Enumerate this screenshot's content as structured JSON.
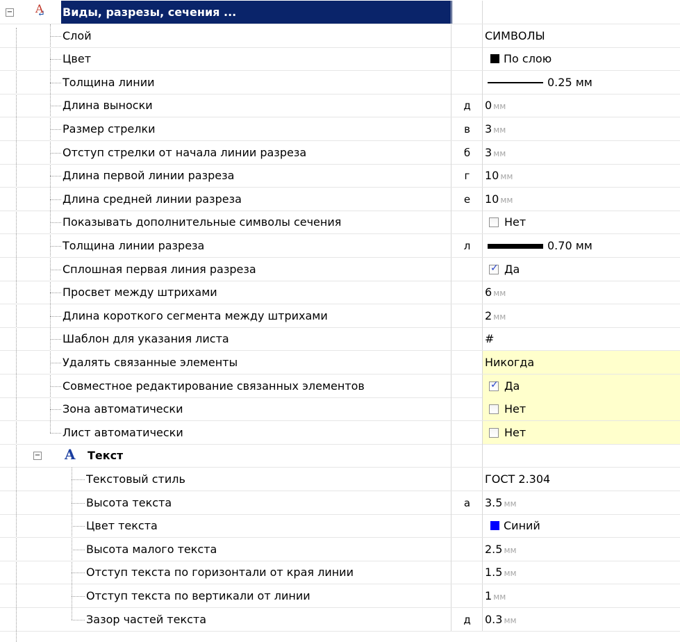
{
  "sections": [
    {
      "title": "Виды, разрезы, сечения ...",
      "icon": "section-view-icon",
      "selected": true,
      "rows": [
        {
          "name": "Слой",
          "key": "",
          "type": "text",
          "value": "СИМВОЛЫ"
        },
        {
          "name": "Цвет",
          "key": "",
          "type": "color",
          "value": "По слою",
          "color": "#000000"
        },
        {
          "name": "Толщина линии",
          "key": "",
          "type": "lineweight",
          "value": "0.25 мм",
          "weight": 2
        },
        {
          "name": "Длина выноски",
          "key": "д",
          "type": "unit",
          "value": "0",
          "unit": "мм"
        },
        {
          "name": "Размер стрелки",
          "key": "в",
          "type": "unit",
          "value": "3",
          "unit": "мм"
        },
        {
          "name": "Отступ стрелки от начала линии разреза",
          "key": "б",
          "type": "unit",
          "value": "3",
          "unit": "мм"
        },
        {
          "name": "Длина первой линии разреза",
          "key": "г",
          "type": "unit",
          "value": "10",
          "unit": "мм"
        },
        {
          "name": "Длина средней линии разреза",
          "key": "е",
          "type": "unit",
          "value": "10",
          "unit": "мм"
        },
        {
          "name": "Показывать дополнительные символы сечения",
          "key": "",
          "type": "check",
          "checked": false,
          "value": "Нет"
        },
        {
          "name": "Толщина линии разреза",
          "key": "л",
          "type": "lineweight",
          "value": "0.70 мм",
          "weight": 7
        },
        {
          "name": "Сплошная первая линия разреза",
          "key": "",
          "type": "check",
          "checked": true,
          "value": "Да"
        },
        {
          "name": "Просвет между штрихами",
          "key": "",
          "type": "unit",
          "value": "6",
          "unit": "мм"
        },
        {
          "name": "Длина короткого сегмента между штрихами",
          "key": "",
          "type": "unit",
          "value": "2",
          "unit": "мм"
        },
        {
          "name": "Шаблон для указания листа",
          "key": "",
          "type": "text",
          "value": "#"
        },
        {
          "name": "Удалять связанные элементы",
          "key": "",
          "type": "text",
          "value": "Никогда",
          "highlight": true
        },
        {
          "name": "Совместное редактирование связанных элементов",
          "key": "",
          "type": "check",
          "checked": true,
          "value": "Да",
          "highlight": true
        },
        {
          "name": "Зона автоматически",
          "key": "",
          "type": "check",
          "checked": false,
          "value": "Нет",
          "highlight": true
        },
        {
          "name": "Лист автоматически",
          "key": "",
          "type": "check",
          "checked": false,
          "value": "Нет",
          "highlight": true
        }
      ]
    },
    {
      "title": "Текст",
      "icon": "text-style-icon",
      "selected": false,
      "rows": [
        {
          "name": "Текстовый стиль",
          "key": "",
          "type": "text",
          "value": "ГОСТ 2.304"
        },
        {
          "name": "Высота текста",
          "key": "а",
          "type": "unit",
          "value": "3.5",
          "unit": "мм"
        },
        {
          "name": "Цвет текста",
          "key": "",
          "type": "color",
          "value": "Синий",
          "color": "#0000ff"
        },
        {
          "name": "Высота малого текста",
          "key": "",
          "type": "unit",
          "value": "2.5",
          "unit": "мм"
        },
        {
          "name": "Отступ текста по горизонтали от края линии",
          "key": "",
          "type": "unit",
          "value": "1.5",
          "unit": "мм"
        },
        {
          "name": "Отступ текста по вертикали от линии",
          "key": "",
          "type": "unit",
          "value": "1",
          "unit": "мм"
        },
        {
          "name": "Зазор частей текста",
          "key": "д",
          "type": "unit",
          "value": "0.3",
          "unit": "мм"
        }
      ]
    }
  ],
  "icons": {
    "expander": "minus-expander-icon",
    "checkmark": "✓"
  }
}
